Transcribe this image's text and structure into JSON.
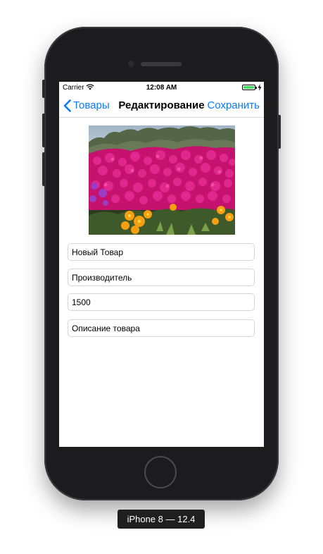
{
  "status_bar": {
    "carrier": "Carrier",
    "time": "12:08 AM",
    "wifi_icon": "wifi-icon",
    "battery_icon": "battery-icon",
    "battery_level": 1.0,
    "charging_icon": "bolt-icon"
  },
  "nav": {
    "back_label": "Товары",
    "back_icon": "chevron-left-icon",
    "title": "Редактирование",
    "save_label": "Сохранить"
  },
  "product_image": {
    "semantic": "flowers-photo"
  },
  "fields": {
    "name": "Новый Товар",
    "manufacturer": "Производитель",
    "price": "1500",
    "description": "Описание товара"
  },
  "device_label": "iPhone 8 — 12.4",
  "colors": {
    "accent": "#0a7aff",
    "device_body": "#1c1c1e",
    "battery_fill": "#4cd964"
  }
}
